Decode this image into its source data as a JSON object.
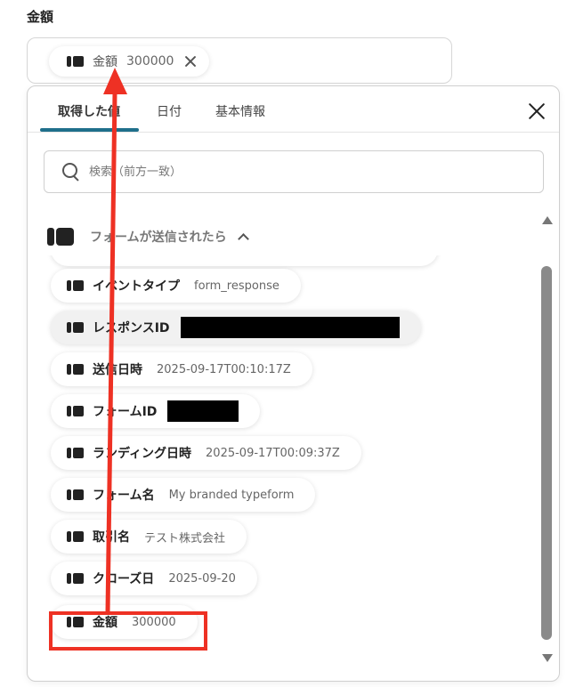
{
  "field": {
    "label": "金額",
    "chip": {
      "name": "金額",
      "value": "300000"
    }
  },
  "tabs": [
    {
      "label": "取得した値",
      "active": true
    },
    {
      "label": "日付",
      "active": false
    },
    {
      "label": "基本情報",
      "active": false
    }
  ],
  "search": {
    "placeholder": "検索（前方一致）"
  },
  "group": {
    "title": "フォームが送信されたら"
  },
  "items": [
    {
      "name": "イベントタイプ",
      "value": "form_response"
    },
    {
      "name": "レスポンスID",
      "value": ""
    },
    {
      "name": "送信日時",
      "value": "2025-09-17T00:10:17Z"
    },
    {
      "name": "フォームID",
      "value": ""
    },
    {
      "name": "ランディング日時",
      "value": "2025-09-17T00:09:37Z"
    },
    {
      "name": "フォーム名",
      "value": "My branded typeform"
    },
    {
      "name": "取引名",
      "value": "テスト株式会社"
    },
    {
      "name": "クローズ日",
      "value": "2025-09-20"
    },
    {
      "name": "金額",
      "value": "300000"
    }
  ],
  "colors": {
    "accent": "#1f6f8b",
    "annotation": "#ee3124"
  }
}
